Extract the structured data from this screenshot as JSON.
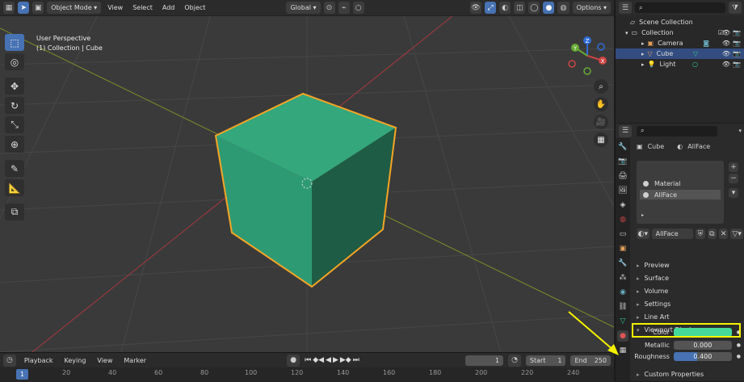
{
  "viewport": {
    "header": {
      "mode": "Object Mode",
      "menus": [
        "View",
        "Select",
        "Add",
        "Object"
      ],
      "transform": "Global",
      "options": "Options"
    },
    "info_line1": "User Perspective",
    "info_line2": "(1) Collection | Cube",
    "gizmo": {
      "z": "Z",
      "y": "Y",
      "x": "X"
    }
  },
  "timeline": {
    "menus": [
      "Playback",
      "Keying",
      "View",
      "Marker"
    ],
    "current_frame": "1",
    "start_label": "Start",
    "start_value": "1",
    "end_label": "End",
    "end_value": "250",
    "ruler": [
      "1",
      "20",
      "40",
      "60",
      "80",
      "100",
      "120",
      "140",
      "160",
      "180",
      "200",
      "220",
      "240"
    ]
  },
  "outliner": {
    "scene_collection": "Scene Collection",
    "collection": "Collection",
    "items": [
      {
        "name": "Camera",
        "selected": false
      },
      {
        "name": "Cube",
        "selected": true
      },
      {
        "name": "Light",
        "selected": false
      }
    ]
  },
  "properties": {
    "object_name": "Cube",
    "material_name": "AllFace",
    "slots": [
      {
        "name": "Material",
        "selected": false
      },
      {
        "name": "AllFace",
        "selected": true
      }
    ],
    "material_field": "AllFace",
    "panels": [
      "Preview",
      "Surface",
      "Volume",
      "Settings",
      "Line Art",
      "Viewport Display"
    ],
    "viewport_display": {
      "color_label": "Color",
      "color_value": "#45d99b",
      "metallic_label": "Metallic",
      "metallic_value": "0.000",
      "metallic_fraction": 0,
      "roughness_label": "Roughness",
      "roughness_value": "0.400",
      "roughness_fraction": 0.4
    },
    "custom_properties": "Custom Properties"
  },
  "colors": {
    "accent": "#4772b3",
    "cube": "#2e9a74",
    "selection_outline": "#f5a524",
    "highlight": "#f5f200"
  }
}
